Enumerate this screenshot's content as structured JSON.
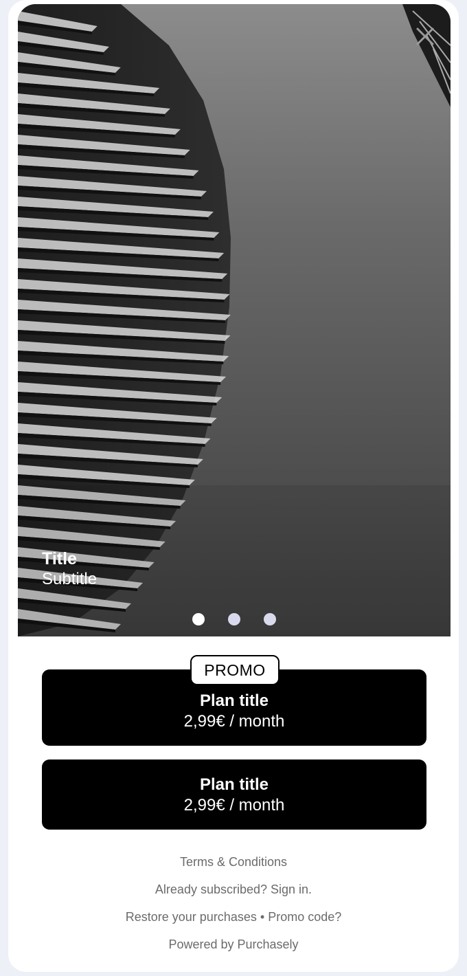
{
  "hero": {
    "title": "Title",
    "subtitle": "Subtitle",
    "image_icon": "building-photo",
    "close_icon": "close-icon"
  },
  "pagination": {
    "total": 3,
    "active_index": 0
  },
  "plans": [
    {
      "badge": "PROMO",
      "title": "Plan title",
      "price": "2,99€ / month"
    },
    {
      "title": "Plan title",
      "price": "2,99€ / month"
    }
  ],
  "footer": {
    "terms": "Terms & Conditions",
    "already_subscribed": "Already subscribed? Sign in.",
    "restore": "Restore your purchases",
    "separator": "•",
    "promo_code": "Promo code?",
    "powered_by": "Powered by Purchasely"
  },
  "colors": {
    "page_background": "#eef0f8",
    "card_background": "#ffffff",
    "plan_background": "#000000",
    "plan_text": "#ffffff",
    "footer_text": "#6b6b6b",
    "dot_inactive": "#d9d9ee",
    "dot_active": "#ffffff"
  }
}
